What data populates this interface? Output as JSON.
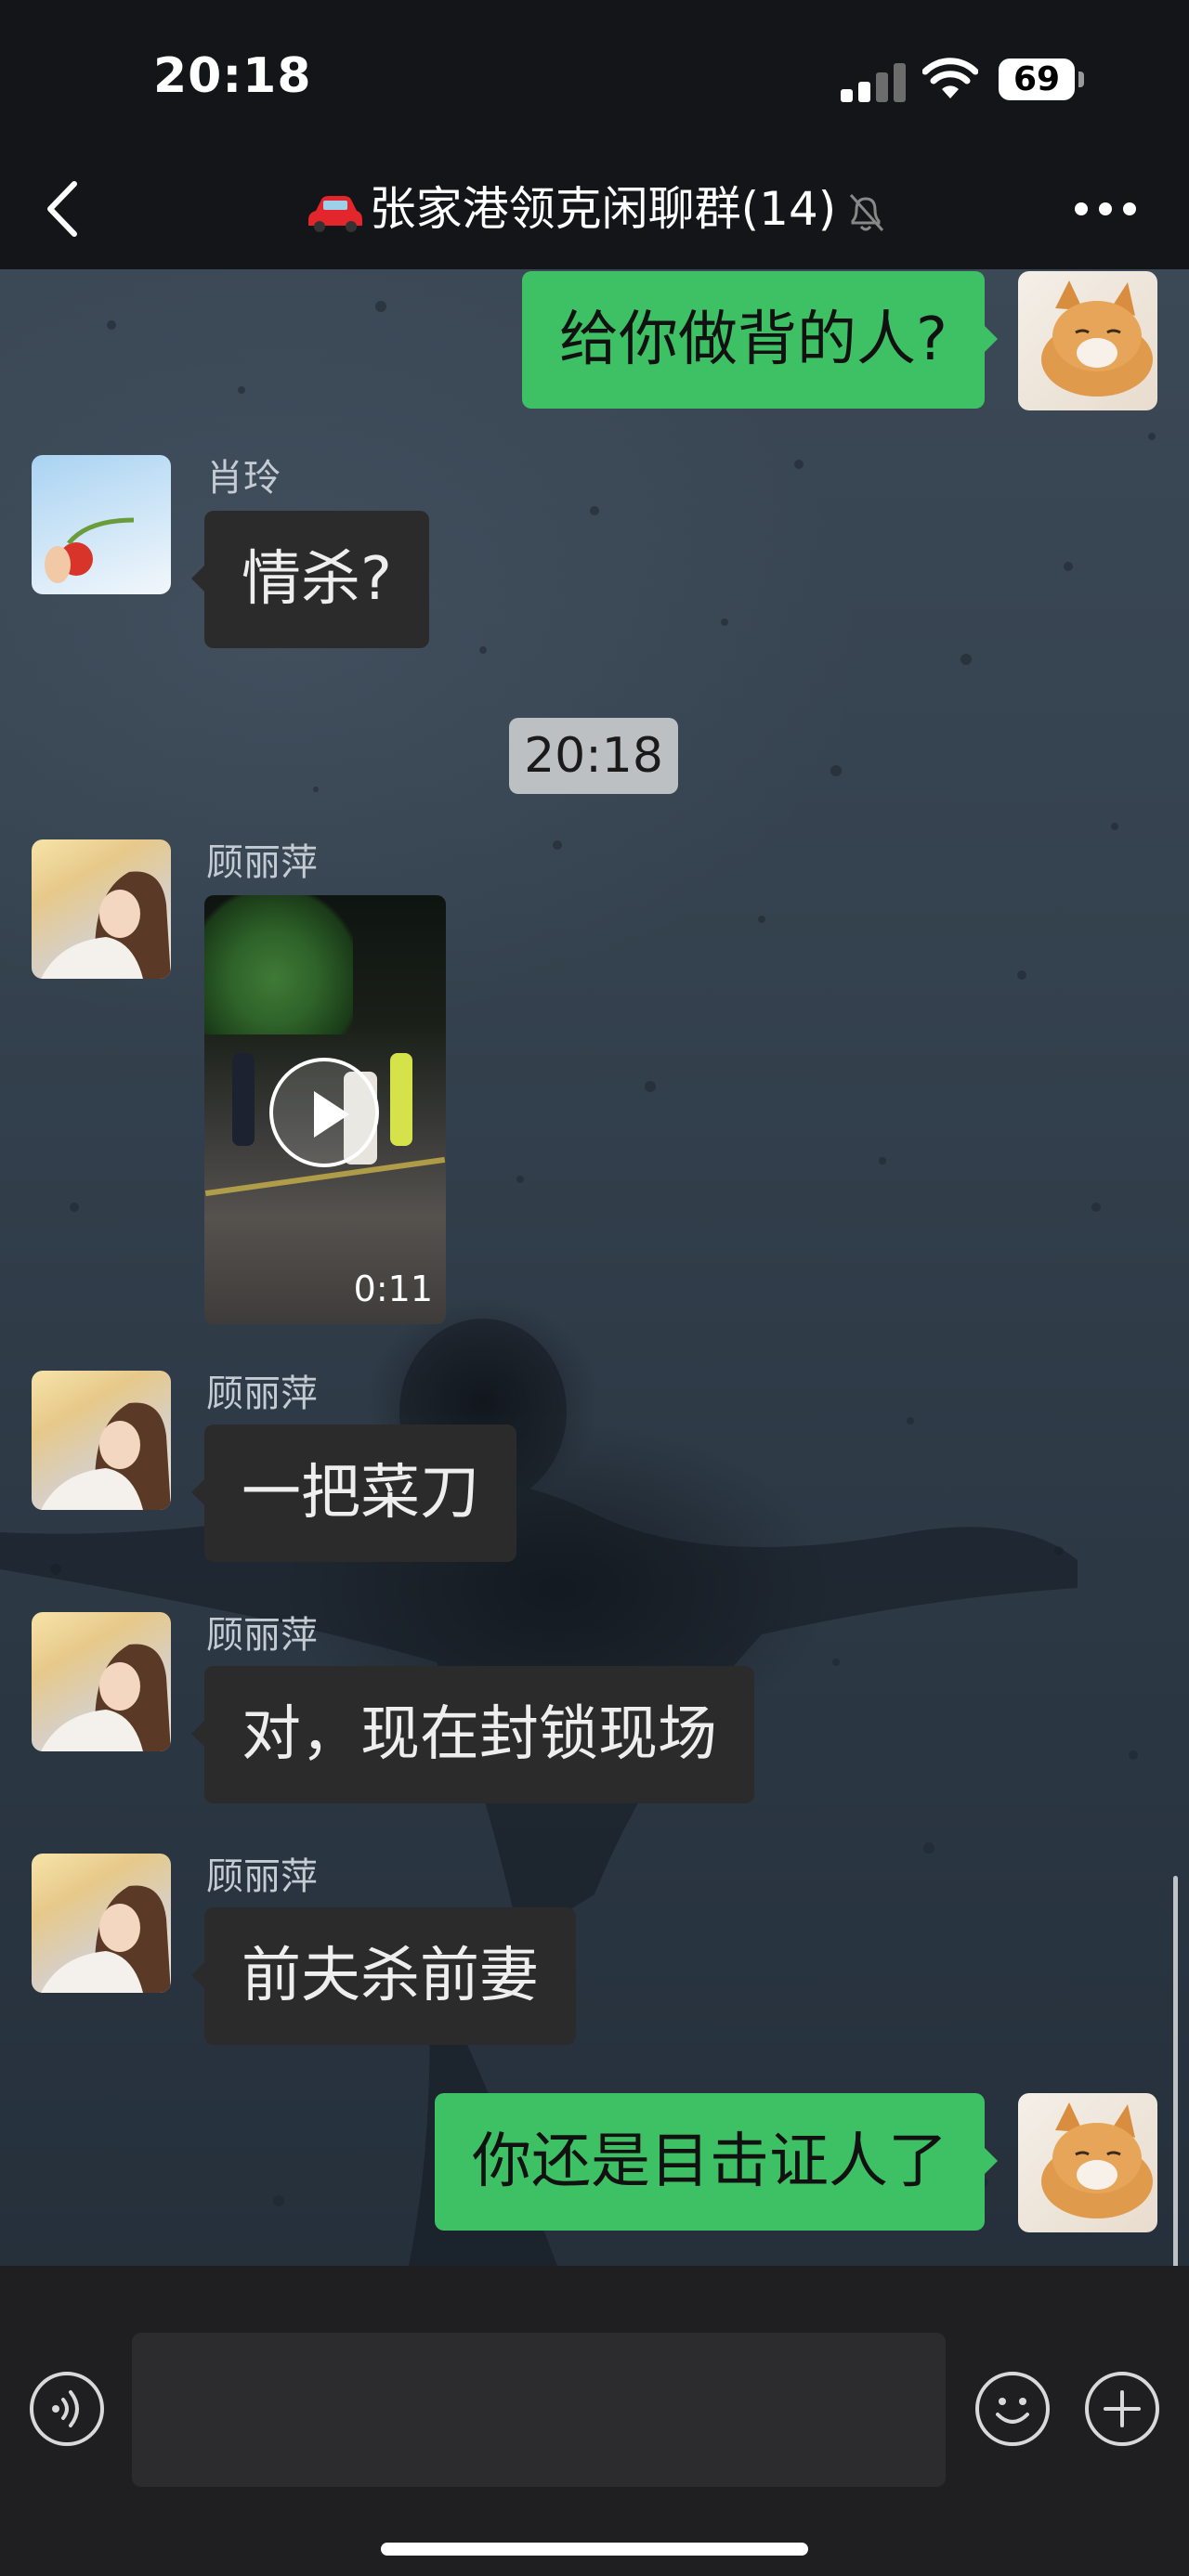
{
  "status_bar": {
    "time": "20:18",
    "battery": "69"
  },
  "nav": {
    "title": "🚗张家港领克闲聊群(14)",
    "title_text": "张家港领克闲聊群(14)",
    "back_icon": "chevron-left-icon",
    "mute_icon": "bell-slash-icon",
    "more_icon": "more-dots-icon"
  },
  "messages": [
    {
      "side": "out",
      "sender": "",
      "text": "给你做背的人?"
    },
    {
      "side": "in",
      "sender": "肖玲",
      "text": "情杀?"
    },
    {
      "type": "time",
      "text": "20:18"
    },
    {
      "side": "in",
      "sender": "顾丽萍",
      "type": "video",
      "duration": "0:11"
    },
    {
      "side": "in",
      "sender": "顾丽萍",
      "text": "一把菜刀"
    },
    {
      "side": "in",
      "sender": "顾丽萍",
      "text": "对，现在封锁现场"
    },
    {
      "side": "in",
      "sender": "顾丽萍",
      "text": "前夫杀前妻"
    },
    {
      "side": "out",
      "sender": "",
      "text": "你还是目击证人了"
    }
  ],
  "input_bar": {
    "placeholder": "",
    "voice_icon": "voice-icon",
    "emoji_icon": "emoji-icon",
    "plus_icon": "plus-icon"
  },
  "colors": {
    "outgoing_bubble": "#3ec064",
    "incoming_bubble": "#2b2b2b",
    "time_divider": "#bdc0c2"
  }
}
